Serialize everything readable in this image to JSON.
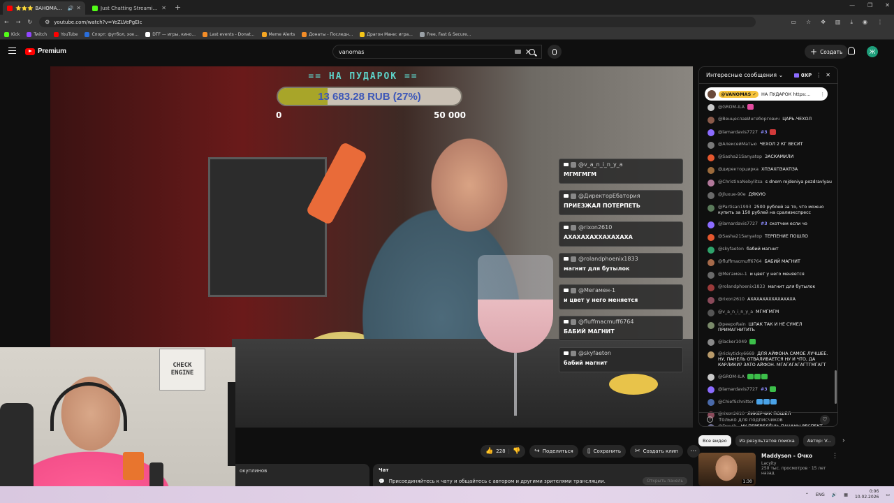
{
  "browser": {
    "tabs": [
      {
        "title": "⭐⭐⭐ ВАНОМАС ДЕН...",
        "active": true,
        "color": "#ff0000"
      },
      {
        "title": "Just Chatting Streaming - Live",
        "active": false,
        "color": "#53fc18"
      }
    ],
    "url": "youtube.com/watch?v=YeZLVePgEIc",
    "bookmarks": [
      {
        "label": "Kick",
        "color": "#53fc18"
      },
      {
        "label": "Twitch",
        "color": "#9146ff"
      },
      {
        "label": "YouTube",
        "color": "#ff0000"
      },
      {
        "label": "Спорт: футбол, хок...",
        "color": "#2a6edb"
      },
      {
        "label": "DTF — игры, кино...",
        "color": "#ffffff"
      },
      {
        "label": "Last events - Donat...",
        "color": "#f28c28"
      },
      {
        "label": "Meme Alerts",
        "color": "#f5a623"
      },
      {
        "label": "Донаты - Последн...",
        "color": "#f28c28"
      },
      {
        "label": "Драгон Мани: игра...",
        "color": "#f5c518"
      },
      {
        "label": "Free, Fast & Secure...",
        "color": "#9aa0a6"
      }
    ]
  },
  "youtube": {
    "logo_text": "Premium",
    "search_value": "vanomas",
    "create_label": "Создать",
    "avatar_letter": "Ж"
  },
  "overlay": {
    "donate_title": "== НА ПУДАРОК ==",
    "donate_text": "13 683.28 RUB (27%)",
    "donate_progress": 0.27,
    "donate_min": "0",
    "donate_max": "50 000",
    "chat": [
      {
        "author": "@v_a_n_i_n_y_a",
        "text": "МГМГМГМ"
      },
      {
        "author": "@ДиректорЕбатория",
        "text": "ПРИЕЗЖАЛ ПОТЕРПЕТЬ"
      },
      {
        "author": "@rixon2610",
        "text": "АХАХАХАХХАХАХАХА"
      },
      {
        "author": "@rolandphoenix1833",
        "text": "магнит для бутылок"
      },
      {
        "author": "@Мегамен-1",
        "text": "и цвет у него меняется"
      },
      {
        "author": "@fluffmacmuff6764",
        "text": "БАБИЙ МАГНИТ"
      },
      {
        "author": "@skyfaeton",
        "text": "бабий магнит"
      }
    ]
  },
  "webcam": {
    "poster_text": "CHECK ENGINE"
  },
  "actions": {
    "likes": "228",
    "share": "Поделиться",
    "save": "Сохранить",
    "clip": "Создать клип"
  },
  "description_snippet": "окуплинов",
  "chat_area": {
    "label": "Чат",
    "invite": "Присоединяйтесь к чату и общайтесь с автором и другими зрителями трансляции.",
    "open_btn": "Открыть панель"
  },
  "livechat": {
    "header": "Интересные сообщения",
    "xp": "0XP",
    "pinned_channel": "@VANOMAS ✓",
    "pinned_text": "НА ПУДАРОК https:...",
    "messages": [
      {
        "author": "@GROM-ILA",
        "text": "",
        "avatar": "#c9c9c9",
        "emotes": [
          "#e44ca0"
        ]
      },
      {
        "author": "@ВенцеславИнгеборгович",
        "text": "ЦАРЬ-ЧЕХОЛ",
        "avatar": "#8a5a4a",
        "emotes": []
      },
      {
        "author": "@lamardavis7727",
        "badge": "#3",
        "text": "",
        "avatar": "#8c6cff",
        "emotes": [
          "#d23a3a"
        ]
      },
      {
        "author": "@АлексейМатью",
        "text": "ЧЕХОЛ 2 КГ ВЕСИТ",
        "avatar": "#7a7a7a",
        "emotes": []
      },
      {
        "author": "@Sasha21Sanyatop",
        "text": "ЗАСКАМИЛИ",
        "avatar": "#e4572e",
        "emotes": []
      },
      {
        "author": "@директорцирка",
        "text": "ХПЗАХПЗАХПЗА",
        "avatar": "#9c6b3c",
        "emotes": []
      },
      {
        "author": "@ChristinaNebylitsa",
        "text": "s dnem rojdeniya pozdravlyau",
        "avatar": "#b2789a",
        "emotes": []
      },
      {
        "author": "@Jluxue-90e",
        "text": "ДЯКУЮ",
        "avatar": "#6a6a6a",
        "emotes": []
      },
      {
        "author": "@Partisan1993",
        "text": "2500 рублей за то, что можно купить за 150 рублей на сралиэкспресс",
        "avatar": "#5a7a5a",
        "emotes": []
      },
      {
        "author": "@lamardavis7727",
        "badge": "#3",
        "text": "скотчем если чо",
        "avatar": "#8c6cff",
        "emotes": []
      },
      {
        "author": "@Sasha21Sanyatop",
        "text": "ТЕРПЕНИЕ ПОШЛО",
        "avatar": "#e4572e",
        "emotes": []
      },
      {
        "author": "@skyfaeton",
        "text": "бабий магнит",
        "avatar": "#2fa36b",
        "emotes": []
      },
      {
        "author": "@fluffmacmuff6764",
        "text": "БАБИЙ МАГНИТ",
        "avatar": "#a66a4a",
        "emotes": []
      },
      {
        "author": "@Мегамен-1",
        "text": "и цвет у него меняется",
        "avatar": "#6a6a6a",
        "emotes": []
      },
      {
        "author": "@rolandphoenix1833",
        "text": "магнит для бутылок",
        "avatar": "#9a3a3a",
        "emotes": []
      },
      {
        "author": "@rixon2610",
        "text": "АХАХАХАХХАХАХАХА",
        "avatar": "#8a4a5a",
        "emotes": []
      },
      {
        "author": "@v_a_n_i_n_y_a",
        "text": "МГМГМГМ",
        "avatar": "#555555",
        "emotes": []
      },
      {
        "author": "@peepoRain",
        "text": "ШПАК ТАК И НЕ СУМЕЛ ПРИМАГНИТИТЬ",
        "avatar": "#7a8a6a",
        "emotes": []
      },
      {
        "author": "@lacker1049",
        "text": "",
        "avatar": "#8a8a8a",
        "emotes": [
          "#3cbf4a"
        ]
      },
      {
        "author": "@rickyticky6669",
        "text": "ДЛЯ АЙФОНА САМОЕ ЛУЧШЕЕ. НУ, ПАНЕЛЬ ОТВАЛИВАЕТСЯ НУ И ЧТО, ДА КАРЛИКИ? ЗАТО АЙФОН. МГАГАГАГАГТГМГАГТ",
        "avatar": "#b89a6a",
        "emotes": []
      },
      {
        "author": "@GROM-ILA",
        "text": "",
        "avatar": "#c9c9c9",
        "emotes": [
          "#3cbf4a",
          "#3cbf4a",
          "#3cbf4a"
        ]
      },
      {
        "author": "@lamardavis7727",
        "badge": "#3",
        "text": "",
        "avatar": "#8c6cff",
        "emotes": [
          "#3cbf4a"
        ]
      },
      {
        "author": "@ChiefSchnitter",
        "text": "",
        "avatar": "#4a6aaa",
        "emotes": [
          "#4aa3e8",
          "#4aa3e8",
          "#4aa3e8"
        ]
      },
      {
        "author": "@rixon2610",
        "text": "ЛИКЕРЧИК ПОШЕЛ",
        "avatar": "#8a4a5a",
        "emotes": []
      },
      {
        "author": "@Den4k.",
        "text": "НУ ПЕРЕВЕДЁШЬ ПАЦАНЫ РЕСПЕКТ СКАЖУТ",
        "avatar": "#6a6a8a",
        "emotes": []
      }
    ],
    "footer": "Только для подписчиков"
  },
  "recommendations": {
    "chips": [
      {
        "label": "Все видео",
        "active": true
      },
      {
        "label": "Из результатов поиска",
        "active": false
      },
      {
        "label": "Автор: V...",
        "active": false
      }
    ],
    "video": {
      "title": "Maddyson - Очко",
      "channel": "Lacyity",
      "stats": "250 тыс. просмотров · 15 лет назад",
      "duration": "1:30"
    }
  },
  "taskbar": {
    "lang": "ENG",
    "time": "0:06",
    "date": "10.02.2026"
  }
}
